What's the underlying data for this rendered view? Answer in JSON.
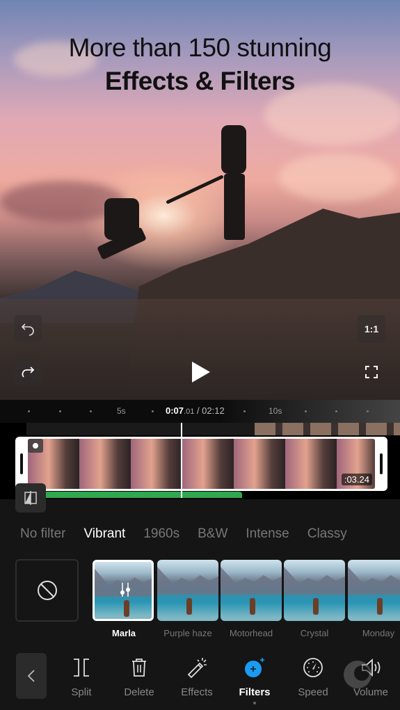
{
  "headline": {
    "line1": "More than 150 stunning",
    "line2": "Effects & Filters"
  },
  "preview_controls": {
    "undo_icon": "undo-icon",
    "redo_icon": "redo-icon",
    "aspect_ratio_label": "1:1",
    "fullscreen_icon": "fullscreen-icon",
    "play_icon": "play-icon"
  },
  "ruler": {
    "tick_5s": "5s",
    "tick_10s": "10s",
    "current_time_main": "0:07",
    "current_time_ms": ".01",
    "total_time": " / 02:12"
  },
  "clip": {
    "duration": ":03.24"
  },
  "filter_categories": [
    {
      "label": "No filter",
      "active": false
    },
    {
      "label": "Vibrant",
      "active": true
    },
    {
      "label": "1960s",
      "active": false
    },
    {
      "label": "B&W",
      "active": false
    },
    {
      "label": "Intense",
      "active": false
    },
    {
      "label": "Classy",
      "active": false
    }
  ],
  "filters": [
    {
      "label": "Marla",
      "selected": true
    },
    {
      "label": "Purple haze",
      "selected": false
    },
    {
      "label": "Motorhead",
      "selected": false
    },
    {
      "label": "Crystal",
      "selected": false
    },
    {
      "label": "Monday",
      "selected": false
    }
  ],
  "toolbar": {
    "items": [
      {
        "label": "Split",
        "icon": "split-icon",
        "active": false
      },
      {
        "label": "Delete",
        "icon": "trash-icon",
        "active": false
      },
      {
        "label": "Effects",
        "icon": "magic-wand-icon",
        "active": false
      },
      {
        "label": "Filters",
        "icon": "filters-icon",
        "active": true
      },
      {
        "label": "Speed",
        "icon": "speedometer-icon",
        "active": false
      },
      {
        "label": "Volume",
        "icon": "volume-icon",
        "active": false
      }
    ]
  },
  "colors": {
    "accent": "#1a9bf0",
    "audio_track": "#2fa84f",
    "background": "#151515"
  }
}
